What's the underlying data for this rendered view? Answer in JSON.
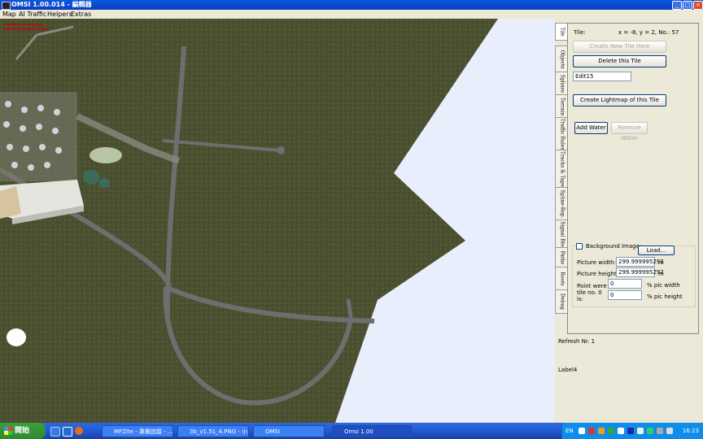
{
  "window": {
    "title": "OMSI 1.00.014 - 編輯器",
    "minimize": "_",
    "maximize": "□",
    "close": "×"
  },
  "menu": [
    "Map",
    "AI Traffic",
    "Helpers",
    "Extras"
  ],
  "viewport_debug": [
    "▪▪▪▪▪▪▪▪ ▪▪▪▪ ▪▪▪▪▪",
    "▪▪▪▪ ▪▪ ▪▪▪▪▪▪▪▪ ▪▪▪▪▪"
  ],
  "tabs": [
    "Tile",
    "Objects",
    "Splines",
    "Terrain",
    "Traffic Rules",
    "Tracks & Tape",
    "Spline-Rep.",
    "Signal Rte",
    "Paths",
    "Roots",
    "Debug"
  ],
  "tile": {
    "tile_label": "Tile:",
    "coords": "x = -8, y = 2, No.: 57",
    "create_tile": "Create New Tile Here",
    "delete_tile": "Delete this Tile",
    "name_value": "Edit15",
    "create_lightmap": "Create Lightmap of this Tile",
    "add_water": "Add Water",
    "remove_water": "Remove Water",
    "background_image": "Background Image:",
    "load": "Load...",
    "picture_width_label": "Picture width:",
    "picture_width_value": "299.999995292",
    "picture_height_label": "Picture height:",
    "picture_height_value": "299.999995292",
    "unit_m": "m",
    "point_label": "Point were tile no. 0 is:",
    "point_x": "0",
    "point_y": "0",
    "pct_width": "% pic width",
    "pct_height": "% pic height"
  },
  "status": {
    "refresh": "Refresh Nr. 1",
    "label4": "Label4"
  },
  "taskbar": {
    "start": "開始",
    "tasks": [
      "MFZite - 專欄追蹤 - ...",
      "3b_v1.51_4.PNG - 小...",
      "OMSI",
      "Omsi 1.00"
    ],
    "lang": "EN",
    "time": "16:23"
  },
  "colors": {
    "terrain": "#4A5030",
    "road": "#6E6E6E",
    "titlebar": "#0A58E0",
    "taskbar": "#245EDC"
  }
}
